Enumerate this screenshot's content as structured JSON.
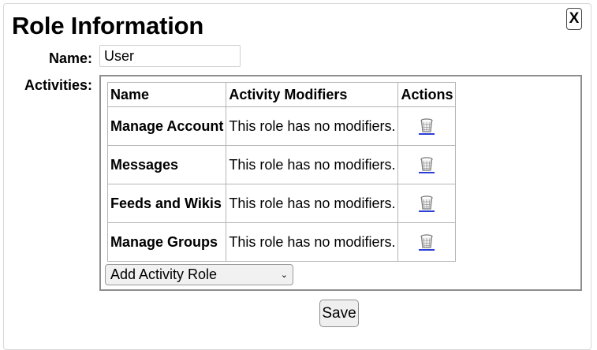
{
  "dialog": {
    "title": "Role Information",
    "close_label": "X"
  },
  "form": {
    "name_label": "Name:",
    "name_value": "User",
    "activities_label": "Activities:"
  },
  "table": {
    "headers": [
      "Name",
      "Activity Modifiers",
      "Actions"
    ],
    "rows": [
      {
        "name": "Manage Account",
        "modifiers": "This role has no modifiers.",
        "action_icon": "trash-icon"
      },
      {
        "name": "Messages",
        "modifiers": "This role has no modifiers.",
        "action_icon": "trash-icon"
      },
      {
        "name": "Feeds and Wikis",
        "modifiers": "This role has no modifiers.",
        "action_icon": "trash-icon"
      },
      {
        "name": "Manage Groups",
        "modifiers": "This role has no modifiers.",
        "action_icon": "trash-icon"
      }
    ]
  },
  "add_activity": {
    "selected": "Add Activity Role"
  },
  "save_label": "Save",
  "colors": {
    "link_underline": "#2a3fd6",
    "box_border": "#8e8e8e",
    "cell_border": "#b5b5b5"
  }
}
